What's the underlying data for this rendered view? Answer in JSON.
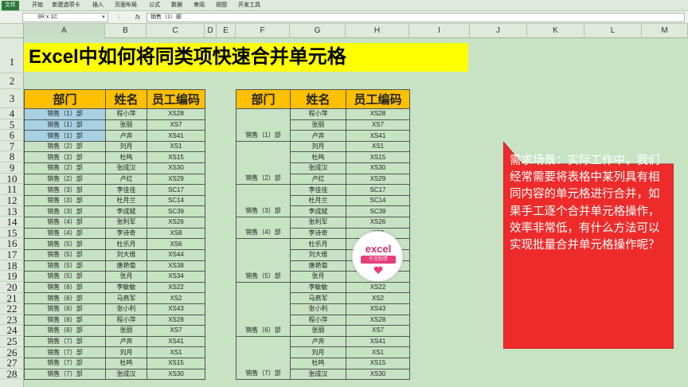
{
  "ribbon": {
    "tabs": [
      "文件",
      "开始",
      "新建选项卡",
      "插入",
      "页面布局",
      "公式",
      "数据",
      "审阅",
      "视图",
      "开发工具"
    ]
  },
  "formula_bar": {
    "name_box": "3R x 1C",
    "fx": "fx",
    "content": "销售（1）部"
  },
  "columns": [
    "A",
    "B",
    "C",
    "D",
    "E",
    "F",
    "G",
    "H",
    "I",
    "J",
    "K",
    "L",
    "M"
  ],
  "rows": [
    "1",
    "2",
    "3",
    "4",
    "5",
    "6",
    "7",
    "8",
    "9",
    "10",
    "11",
    "12",
    "13",
    "14",
    "15",
    "16",
    "17",
    "18",
    "19",
    "20",
    "21",
    "22",
    "23",
    "24",
    "25",
    "26",
    "27",
    "28"
  ],
  "title": "Excel中如何将同类项快速合并单元格",
  "table1": {
    "headers": [
      "部门",
      "姓名",
      "员工编码"
    ],
    "rows": [
      [
        "销售（1）部",
        "程小萍",
        "XS28"
      ],
      [
        "销售（1）部",
        "张丽",
        "XS7"
      ],
      [
        "销售（1）部",
        "卢奔",
        "XS41"
      ],
      [
        "销售（2）部",
        "刘月",
        "XS1"
      ],
      [
        "销售（2）部",
        "杜鸣",
        "XS15"
      ],
      [
        "销售（2）部",
        "张成汉",
        "XS30"
      ],
      [
        "销售（2）部",
        "卢红",
        "XS29"
      ],
      [
        "销售（3）部",
        "李佳佳",
        "SC17"
      ],
      [
        "销售（3）部",
        "杜月兰",
        "SC14"
      ],
      [
        "销售（3）部",
        "李成斌",
        "SC39"
      ],
      [
        "销售（4）部",
        "张利军",
        "XS26"
      ],
      [
        "销售（4）部",
        "李诗奇",
        "XS8"
      ],
      [
        "销售（5）部",
        "杜乐月",
        "XS6"
      ],
      [
        "销售（5）部",
        "刘大维",
        "XS44"
      ],
      [
        "销售（5）部",
        "唐艳菊",
        "XS38"
      ],
      [
        "销售（5）部",
        "张月",
        "XS34"
      ],
      [
        "销售（6）部",
        "李敏敏",
        "XS22"
      ],
      [
        "销售（6）部",
        "马燕军",
        "XS2"
      ],
      [
        "销售（6）部",
        "张小利",
        "XS43"
      ],
      [
        "销售（6）部",
        "程小萍",
        "XS28"
      ],
      [
        "销售（6）部",
        "张丽",
        "XS7"
      ],
      [
        "销售（7）部",
        "卢奔",
        "XS41"
      ],
      [
        "销售（7）部",
        "刘月",
        "XS1"
      ],
      [
        "销售（7）部",
        "杜鸣",
        "XS15"
      ],
      [
        "销售（7）部",
        "张成汉",
        "XS30"
      ]
    ]
  },
  "table2": {
    "headers": [
      "部门",
      "姓名",
      "员工编码"
    ],
    "groups": [
      {
        "dept": "销售（1）部",
        "span": 3
      },
      {
        "dept": "销售（2）部",
        "span": 4
      },
      {
        "dept": "销售（3）部",
        "span": 3
      },
      {
        "dept": "销售（4）部",
        "span": 2
      },
      {
        "dept": "销售（5）部",
        "span": 4
      },
      {
        "dept": "销售（6）部",
        "span": 5
      },
      {
        "dept": "销售（7）部",
        "span": 4
      }
    ],
    "rows": [
      [
        "程小萍",
        "XS28"
      ],
      [
        "张丽",
        "XS7"
      ],
      [
        "卢奔",
        "XS41"
      ],
      [
        "刘月",
        "XS1"
      ],
      [
        "杜鸣",
        "XS15"
      ],
      [
        "张成汉",
        "XS30"
      ],
      [
        "卢红",
        "XS29"
      ],
      [
        "李佳佳",
        "SC17"
      ],
      [
        "杜月兰",
        "SC14"
      ],
      [
        "李成斌",
        "SC39"
      ],
      [
        "张利军",
        "XS26"
      ],
      [
        "李诗奇",
        "XS8"
      ],
      [
        "杜乐月",
        "XS6"
      ],
      [
        "刘大维",
        "XS44"
      ],
      [
        "唐艳菊",
        "XS38"
      ],
      [
        "张月",
        "XS34"
      ],
      [
        "李敏敏",
        "XS22"
      ],
      [
        "马燕军",
        "XS2"
      ],
      [
        "张小利",
        "XS43"
      ],
      [
        "程小萍",
        "XS28"
      ],
      [
        "张丽",
        "XS7"
      ],
      [
        "卢奔",
        "XS41"
      ],
      [
        "刘月",
        "XS1"
      ],
      [
        "杜鸣",
        "XS15"
      ],
      [
        "张成汉",
        "XS30"
      ]
    ]
  },
  "callout": {
    "text": "需求场景：实际工作中，我们经常需要将表格中某列具有相同内容的单元格进行合并，如果手工逐个合并单元格操作，效率非常低，有什么方法可以实现批量合并单元格操作呢？",
    "color": "#ee2b2b"
  },
  "watermark": {
    "logo": "excel",
    "sub": "千万别学"
  },
  "colors": {
    "sheet_bg": "#c7e3c4",
    "title_bg": "#ffff00",
    "header_bg": "#ffc000",
    "selection": "#a8d2e4"
  }
}
